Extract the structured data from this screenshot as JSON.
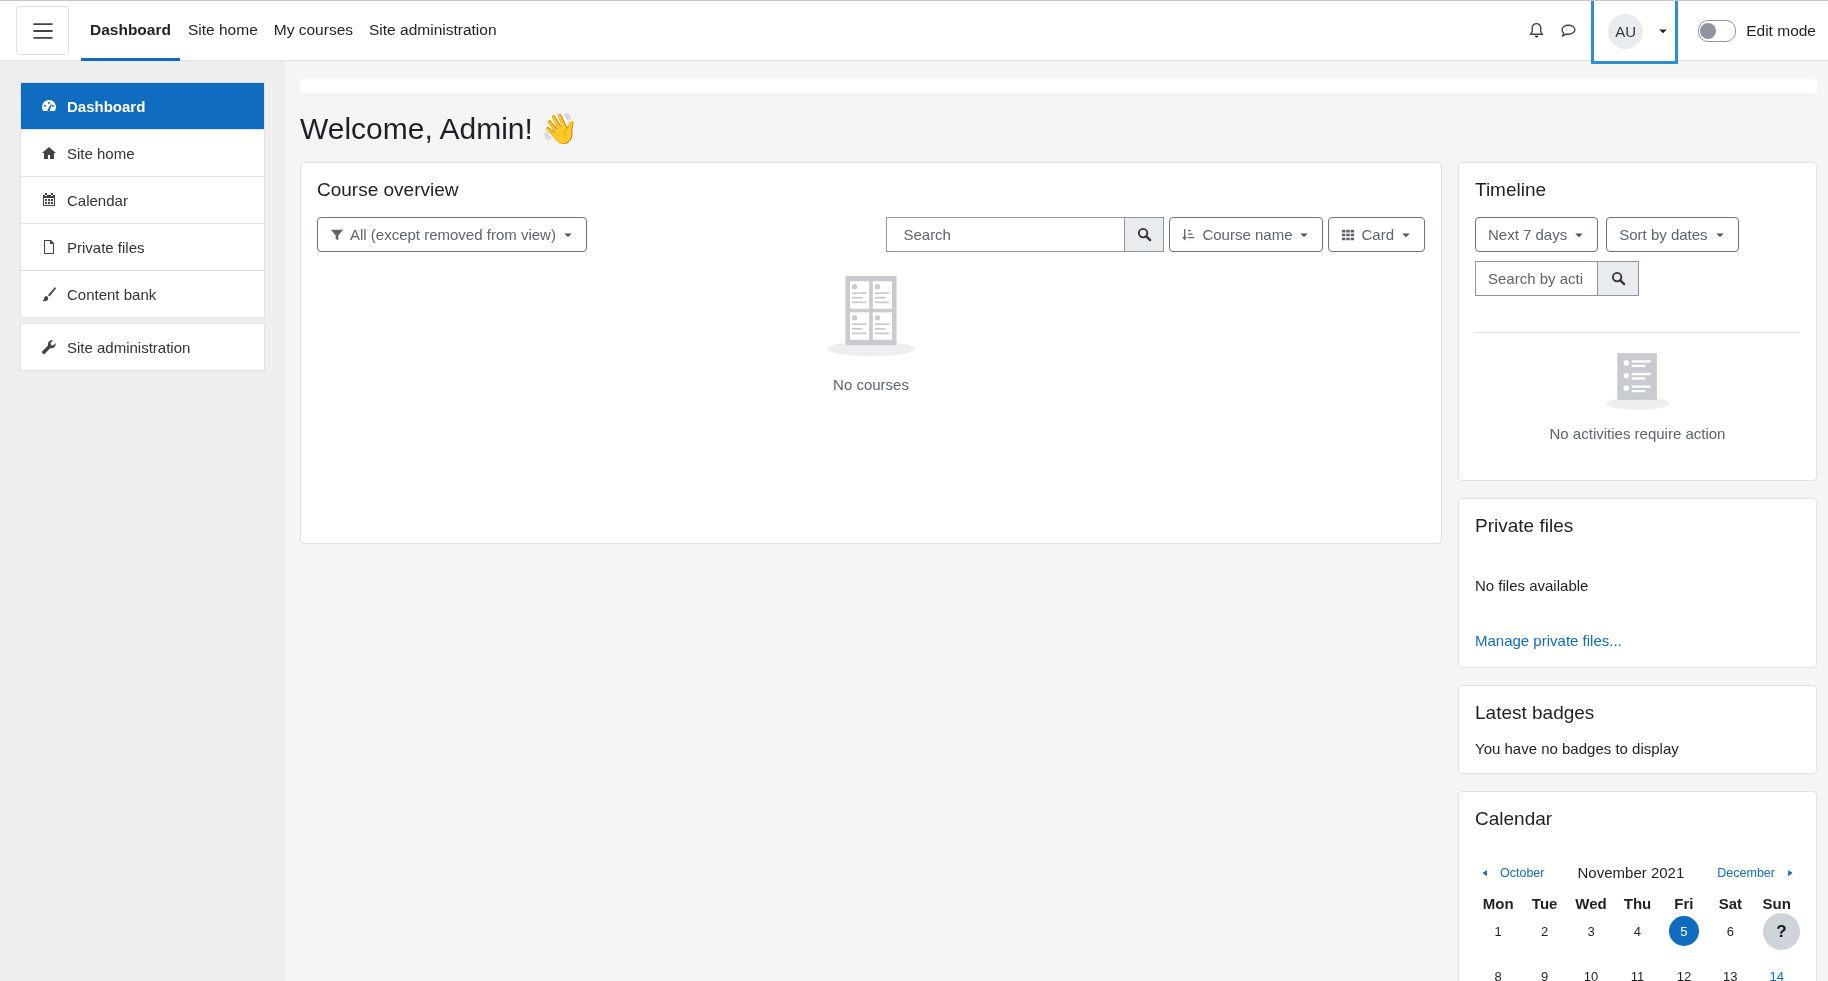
{
  "navbar": {
    "links": [
      {
        "label": "Dashboard",
        "selected": true
      },
      {
        "label": "Site home",
        "selected": false
      },
      {
        "label": "My courses",
        "selected": false
      },
      {
        "label": "Site administration",
        "selected": false
      }
    ],
    "avatar": "AU",
    "edit_mode": {
      "label": "Edit mode",
      "on": false
    }
  },
  "sidebar": {
    "groups": [
      {
        "items": [
          {
            "label": "Dashboard",
            "selected": true
          },
          {
            "label": "Site home",
            "selected": false
          },
          {
            "label": "Calendar",
            "selected": false
          },
          {
            "label": "Private files",
            "selected": false
          },
          {
            "label": "Content bank",
            "selected": false
          }
        ]
      },
      {
        "items": [
          {
            "label": "Site administration",
            "selected": false
          }
        ]
      }
    ]
  },
  "heading": "Welcome, Admin! 👋",
  "course_overview": {
    "title": "Course overview",
    "filter": "All (except removed from view)",
    "search": {
      "placeholder": "Search"
    },
    "sort": "Course name",
    "view": "Card",
    "empty": "No courses"
  },
  "timeline": {
    "title": "Timeline",
    "range": "Next 7 days",
    "sort": "Sort by dates",
    "search": {
      "placeholder": "Search by acti"
    },
    "empty": "No activities require action"
  },
  "private_files": {
    "title": "Private files",
    "message": "No files available",
    "link": "Manage private files..."
  },
  "latest_badges": {
    "title": "Latest badges",
    "message": "You have no badges to display"
  },
  "calendar": {
    "title": "Calendar",
    "prev": "October",
    "month": "November 2021",
    "next": "December",
    "weekdays": [
      "Mon",
      "Tue",
      "Wed",
      "Thu",
      "Fri",
      "Sat",
      "Sun"
    ],
    "weeks": [
      [
        {
          "day": "1",
          "today": false,
          "link": false
        },
        {
          "day": "2",
          "today": false,
          "link": false
        },
        {
          "day": "3",
          "today": false,
          "link": false
        },
        {
          "day": "4",
          "today": false,
          "link": false
        },
        {
          "day": "5",
          "today": true,
          "link": false
        },
        {
          "day": "6",
          "today": false,
          "link": false
        }
      ],
      [
        {
          "day": "8",
          "today": false,
          "link": false
        },
        {
          "day": "9",
          "today": false,
          "link": false
        },
        {
          "day": "10",
          "today": false,
          "link": false
        },
        {
          "day": "11",
          "today": false,
          "link": false
        },
        {
          "day": "12",
          "today": false,
          "link": false
        },
        {
          "day": "13",
          "today": false,
          "link": false
        },
        {
          "day": "14",
          "today": false,
          "link": true
        }
      ]
    ]
  },
  "help_button": "?"
}
